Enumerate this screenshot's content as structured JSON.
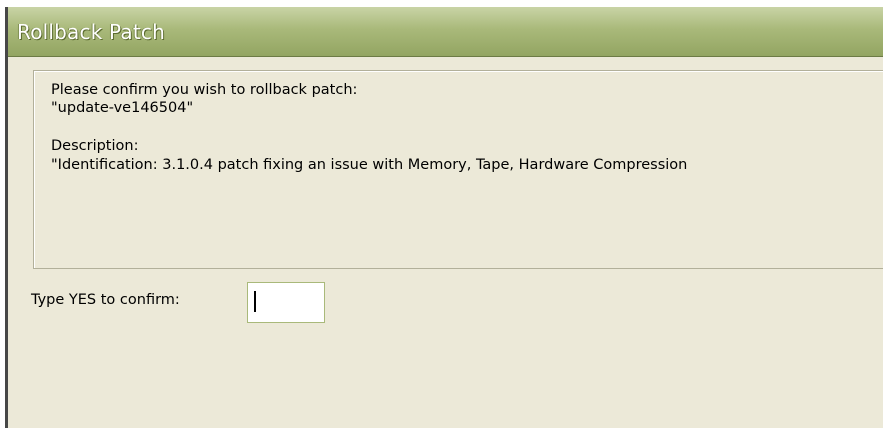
{
  "window": {
    "title": "Rollback Patch"
  },
  "message": {
    "line1": "Please confirm you wish to rollback patch:",
    "patch_name": "\"update-ve146504\"",
    "description_label": "Description:",
    "description_text": "\"Identification: 3.1.0.4 patch fixing an issue with Memory, Tape, Hardware Compression"
  },
  "confirm": {
    "label": "Type YES to confirm:",
    "value": ""
  },
  "colors": {
    "titlebar_top": "#c9d4a6",
    "titlebar_bottom": "#93a562",
    "dialog_background": "#ece9d8",
    "input_border": "#a9b97a"
  }
}
